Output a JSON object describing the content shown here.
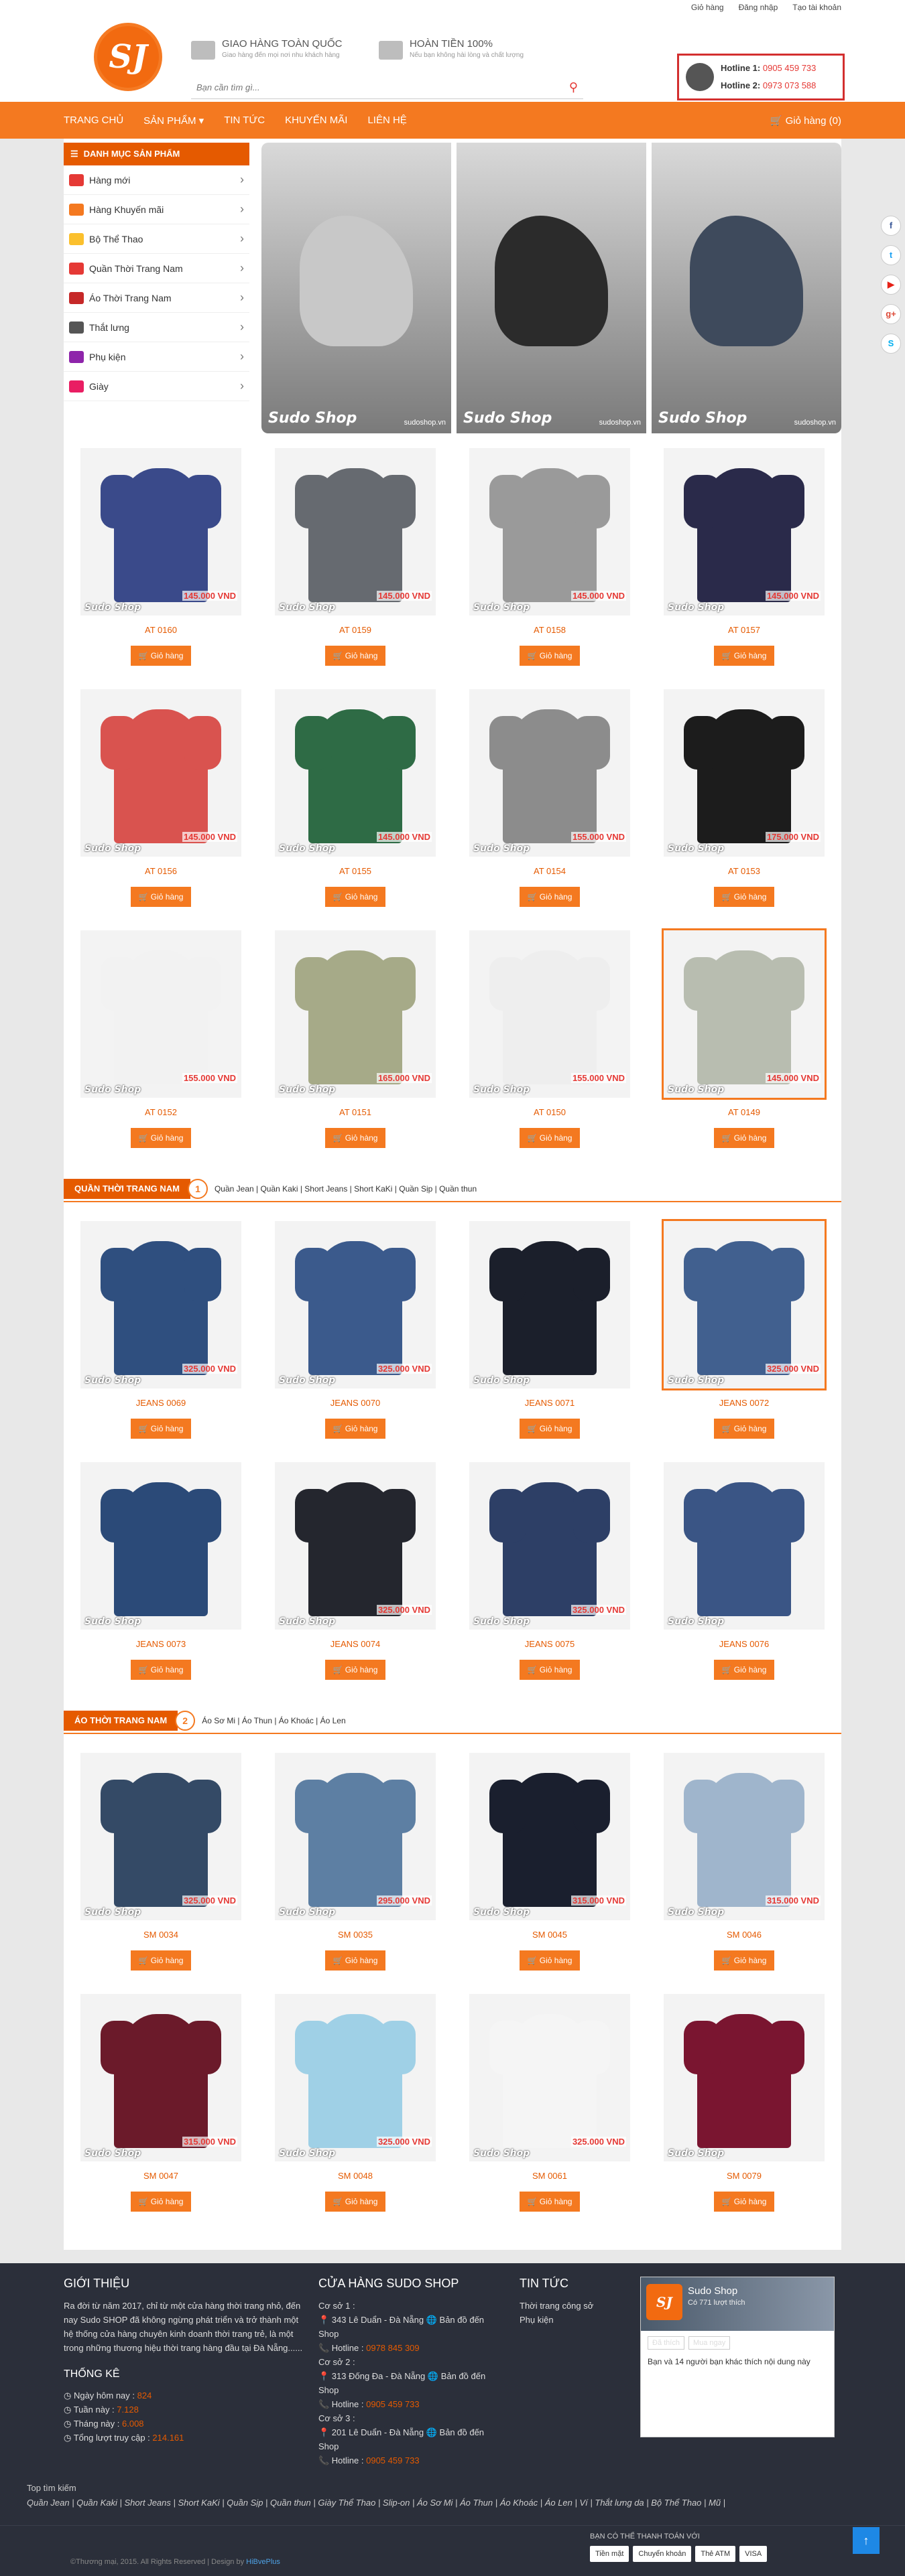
{
  "top_links": [
    "Giỏ hàng",
    "Đăng nhập",
    "Tạo tài khoản"
  ],
  "header": {
    "logo_text": "SJ",
    "promo1_title": "GIAO HÀNG TOÀN QUỐC",
    "promo1_sub": "Giao hàng đến mọi nơi nhu khách hàng",
    "promo2_title": "HOÀN TIỀN 100%",
    "promo2_sub": "Nếu bạn không hài lòng và chất lượng",
    "search_placeholder": "Bạn cần tìm gì...",
    "hotline1_label": "Hotline 1:",
    "hotline1": "0905 459 733",
    "hotline2_label": "Hotline 2:",
    "hotline2": "0973 073 588"
  },
  "nav": {
    "items": [
      "TRANG CHỦ",
      "SẢN PHẨM ▾",
      "TIN TỨC",
      "KHUYẾN MÃI",
      "LIÊN HỆ"
    ],
    "cart": "Giỏ hàng (0)"
  },
  "categories": {
    "title": "DANH MỤC SẢN PHẨM",
    "items": [
      "Hàng mới",
      "Hàng Khuyến mãi",
      "Bộ Thể Thao",
      "Quần Thời Trang Nam",
      "Áo Thời Trang Nam",
      "Thắt lưng",
      "Phụ kiện",
      "Giày"
    ]
  },
  "banner": {
    "watermark": "Sudo Shop",
    "sites": [
      "sudoshop.vn",
      "sudoshop.vn",
      "sudoshop.vn"
    ]
  },
  "button_label": "Giỏ hàng",
  "watermark": "Sudo Shop",
  "products_1": [
    {
      "name": "AT 0160",
      "price": "145.000 VND",
      "c": "#3a4a8a"
    },
    {
      "name": "AT 0159",
      "price": "145.000 VND",
      "c": "#666a70"
    },
    {
      "name": "AT 0158",
      "price": "145.000 VND",
      "c": "#9a9a9a"
    },
    {
      "name": "AT 0157",
      "price": "145.000 VND",
      "c": "#2a2a4a"
    },
    {
      "name": "AT 0156",
      "price": "145.000 VND",
      "c": "#d9534f"
    },
    {
      "name": "AT 0155",
      "price": "145.000 VND",
      "c": "#2e6b45"
    },
    {
      "name": "AT 0154",
      "price": "155.000 VND",
      "c": "#8c8c8c"
    },
    {
      "name": "AT 0153",
      "price": "175.000 VND",
      "c": "#1c1c1c"
    },
    {
      "name": "AT 0152",
      "price": "155.000 VND",
      "c": "#f2f2f2"
    },
    {
      "name": "AT 0151",
      "price": "165.000 VND",
      "c": "#a6aa88"
    },
    {
      "name": "AT 0150",
      "price": "155.000 VND",
      "c": "#eeeeee"
    },
    {
      "name": "AT 0149",
      "price": "145.000 VND",
      "c": "#b8bdb0"
    }
  ],
  "section2": {
    "num": "1",
    "title": "QUẦN THỜI TRANG NAM",
    "links": "Quần Jean | Quần Kaki | Short Jeans | Short KaKi | Quần Sịp | Quần thun"
  },
  "products_2": [
    {
      "name": "JEANS 0069",
      "price": "325.000 VND",
      "c": "#2f4f7f"
    },
    {
      "name": "JEANS 0070",
      "price": "325.000 VND",
      "c": "#3b5a8c"
    },
    {
      "name": "JEANS 0071",
      "price": "",
      "c": "#1b1f2b"
    },
    {
      "name": "JEANS 0072",
      "price": "325.000 VND",
      "c": "#41608f"
    },
    {
      "name": "JEANS 0073",
      "price": "",
      "c": "#2b4a78"
    },
    {
      "name": "JEANS 0074",
      "price": "325.000 VND",
      "c": "#24262e"
    },
    {
      "name": "JEANS 0075",
      "price": "325.000 VND",
      "c": "#2d3f66"
    },
    {
      "name": "JEANS 0076",
      "price": "",
      "c": "#3a5585"
    }
  ],
  "section3": {
    "num": "2",
    "title": "ÁO THỜI TRANG NAM",
    "links": "Áo Sơ Mi | Áo Thun | Áo Khoác | Áo Len"
  },
  "products_3": [
    {
      "name": "SM 0034",
      "price": "325.000 VND",
      "c": "#344a66"
    },
    {
      "name": "SM 0035",
      "price": "295.000 VND",
      "c": "#5d7fa3"
    },
    {
      "name": "SM 0045",
      "price": "315.000 VND",
      "c": "#1a1f2e"
    },
    {
      "name": "SM 0046",
      "price": "315.000 VND",
      "c": "#9fb5cc"
    },
    {
      "name": "SM 0047",
      "price": "315.000 VND",
      "c": "#6b1a2a"
    },
    {
      "name": "SM 0048",
      "price": "325.000 VND",
      "c": "#9fd0e6"
    },
    {
      "name": "SM 0061",
      "price": "325.000 VND",
      "c": "#f5f5f5"
    },
    {
      "name": "SM 0079",
      "price": "",
      "c": "#7a1530"
    }
  ],
  "footer": {
    "intro_title": "GIỚI THIỆU",
    "intro_text": "Ra đời từ năm 2017, chỉ từ một cửa hàng thời trang nhỏ, đến nay Sudo SHOP đã không ngừng phát triển và trở thành một hệ thống cửa hàng chuyên kinh doanh thời trang trẻ, là một trong những thương hiệu thời trang hàng đầu tại Đà Nẵng......",
    "stats_title": "THỐNG KÊ",
    "stats": [
      {
        "label": "Ngày hôm nay :",
        "value": "824"
      },
      {
        "label": "Tuần này :",
        "value": "7.128"
      },
      {
        "label": "Tháng này :",
        "value": "6.008"
      },
      {
        "label": "Tổng lượt truy cập :",
        "value": "214.161"
      }
    ],
    "stores_title": "CỬA HÀNG SUDO SHOP",
    "stores": [
      {
        "name": "Cơ sở 1 :",
        "addr": "343 Lê Duẩn - Đà Nẵng",
        "map": "Bản đồ đến Shop",
        "hot_label": "Hotline :",
        "hot": "0978 845 309"
      },
      {
        "name": "Cơ sở 2 :",
        "addr": "313 Đống Đa - Đà Nẵng",
        "map": "Bản đồ đến Shop",
        "hot_label": "Hotline :",
        "hot": "0905 459 733"
      },
      {
        "name": "Cơ sở 3 :",
        "addr": "201 Lê Duẩn - Đà Nẵng",
        "map": "Bản đồ đến Shop",
        "hot_label": "Hotline :",
        "hot": "0905 459 733"
      }
    ],
    "news_title": "TIN TỨC",
    "news": [
      "Thời trang công sở",
      "Phụ kiện"
    ],
    "fb_name": "Sudo Shop",
    "fb_likes": "Có 771 lượt thích",
    "fb_like_btn": "Đã thích",
    "fb_share_btn": "Mua ngay",
    "fb_text": "Bạn và 14 người bạn khác thích nội dung này",
    "tags_title": "Top tìm kiếm",
    "tags": "Quần Jean | Quần Kaki | Short Jeans | Short KaKi | Quần Sịp | Quần thun | Giày Thể Thao | Slip-on | Áo Sơ Mi | Áo Thun | Áo Khoác | Áo Len | Ví | Thắt lưng da | Bộ Thể Thao | Mũ |",
    "copyright": "©Thương mại, 2015. All Rights Reserved | Design by ",
    "designer": "HiBvePlus",
    "pay_title": "BẠN CÓ THỂ THANH TOÁN VỚI",
    "pay": [
      "Tiền mặt",
      "Chuyển khoản",
      "Thẻ ATM",
      "VISA"
    ]
  },
  "social": [
    "f",
    "t",
    "▶",
    "g+",
    "S"
  ]
}
